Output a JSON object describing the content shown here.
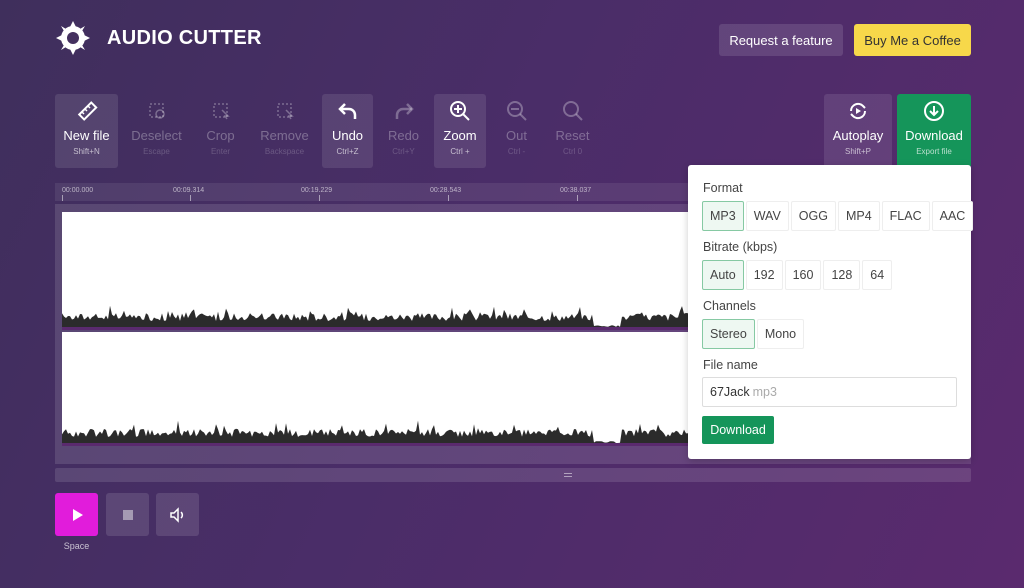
{
  "header": {
    "app_title": "AUDIO CUTTER",
    "logo_icon": "gear-saw-icon",
    "request_label": "Request a feature",
    "coffee_label": "Buy Me a Coffee"
  },
  "toolbar": {
    "new_file": {
      "label": "New file",
      "shortcut": "Shift+N",
      "icon": "ruler-icon"
    },
    "deselect": {
      "label": "Deselect",
      "shortcut": "Escape",
      "icon": "deselect-icon"
    },
    "crop": {
      "label": "Crop",
      "shortcut": "Enter",
      "icon": "crop-icon"
    },
    "remove": {
      "label": "Remove",
      "shortcut": "Backspace",
      "icon": "remove-icon"
    },
    "undo": {
      "label": "Undo",
      "shortcut": "Ctrl+Z",
      "icon": "undo-icon"
    },
    "redo": {
      "label": "Redo",
      "shortcut": "Ctrl+Y",
      "icon": "redo-icon"
    },
    "zoom": {
      "label": "Zoom",
      "shortcut": "Ctrl +",
      "icon": "zoom-in-icon"
    },
    "out": {
      "label": "Out",
      "shortcut": "Ctrl -",
      "icon": "zoom-out-icon"
    },
    "reset": {
      "label": "Reset",
      "shortcut": "Ctrl 0",
      "icon": "zoom-reset-icon"
    },
    "autoplay": {
      "label": "Autoplay",
      "shortcut": "Shift+P",
      "icon": "autoplay-icon"
    },
    "download": {
      "label": "Download",
      "shortcut": "Export file",
      "icon": "download-icon"
    }
  },
  "timeline": {
    "ticks": [
      "00:00.000",
      "00:09.314",
      "00:19.229",
      "00:28.543",
      "00:38.037"
    ]
  },
  "playback": {
    "play_hint": "Space"
  },
  "export": {
    "format_label": "Format",
    "formats": [
      "MP3",
      "WAV",
      "OGG",
      "MP4",
      "FLAC",
      "AAC"
    ],
    "selected_format": "MP3",
    "bitrate_label": "Bitrate (kbps)",
    "bitrates": [
      "Auto",
      "192",
      "160",
      "128",
      "64"
    ],
    "selected_bitrate": "Auto",
    "channels_label": "Channels",
    "channels": [
      "Stereo",
      "Mono"
    ],
    "selected_channel": "Stereo",
    "filename_label": "File name",
    "filename_value": "67Jack",
    "filename_ext": "mp3",
    "download_label": "Download"
  },
  "colors": {
    "accent_green": "#15955a",
    "play_magenta": "#e11cdb",
    "coffee_yellow": "#f7d84a"
  }
}
